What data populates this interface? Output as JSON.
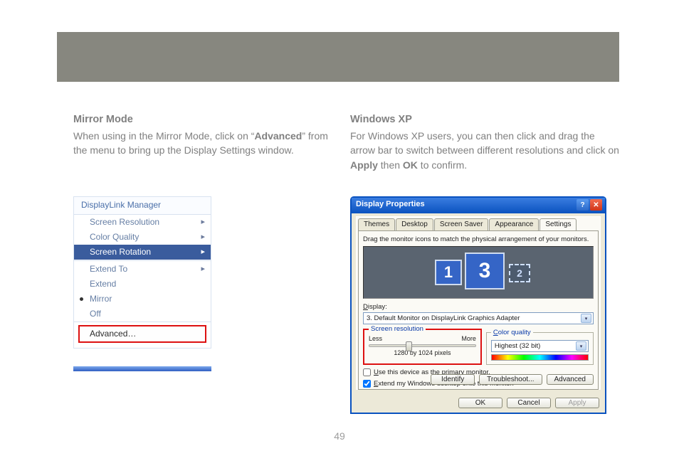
{
  "page_number": "49",
  "left": {
    "heading": "Mirror Mode",
    "para_pre": "When using in the Mirror Mode, click on “",
    "para_bold": "Advanced",
    "para_post": "” from the menu to bring up the Display Settings window."
  },
  "right": {
    "heading": "Windows XP",
    "para_pre": "For Windows XP users, you can then click and drag the arrow bar to switch between different resolutions and click on ",
    "para_bold1": "Apply",
    "para_mid": " then ",
    "para_bold2": "OK",
    "para_post": " to confirm."
  },
  "menu": {
    "header": "DisplayLink Manager",
    "screen_resolution": "Screen Resolution",
    "color_quality": "Color Quality",
    "screen_rotation": "Screen Rotation",
    "extend_to": "Extend To",
    "extend": "Extend",
    "mirror": "Mirror",
    "off": "Off",
    "advanced": "Advanced…"
  },
  "dialog": {
    "title": "Display Properties",
    "tabs": {
      "themes": "Themes",
      "desktop": "Desktop",
      "screensaver": "Screen Saver",
      "appearance": "Appearance",
      "settings": "Settings"
    },
    "instruction": "Drag the monitor icons to match the physical arrangement of your monitors.",
    "monitor1": "1",
    "monitor3": "3",
    "monitor2": "2",
    "display_label_pre": "",
    "display_label": "Display:",
    "display_value": "3. Default Monitor on DisplayLink Graphics Adapter",
    "res_legend": "Screen resolution",
    "res_less": "Less",
    "res_more": "More",
    "res_value": "1280 by 1024 pixels",
    "cq_legend": "Color quality",
    "cq_value": "Highest (32 bit)",
    "chk_primary": "Use this device as the primary monitor.",
    "chk_extend": "Extend my Windows desktop onto this monitor.",
    "identify": "Identify",
    "troubleshoot": "Troubleshoot...",
    "advanced": "Advanced",
    "ok": "OK",
    "cancel": "Cancel",
    "apply": "Apply"
  }
}
